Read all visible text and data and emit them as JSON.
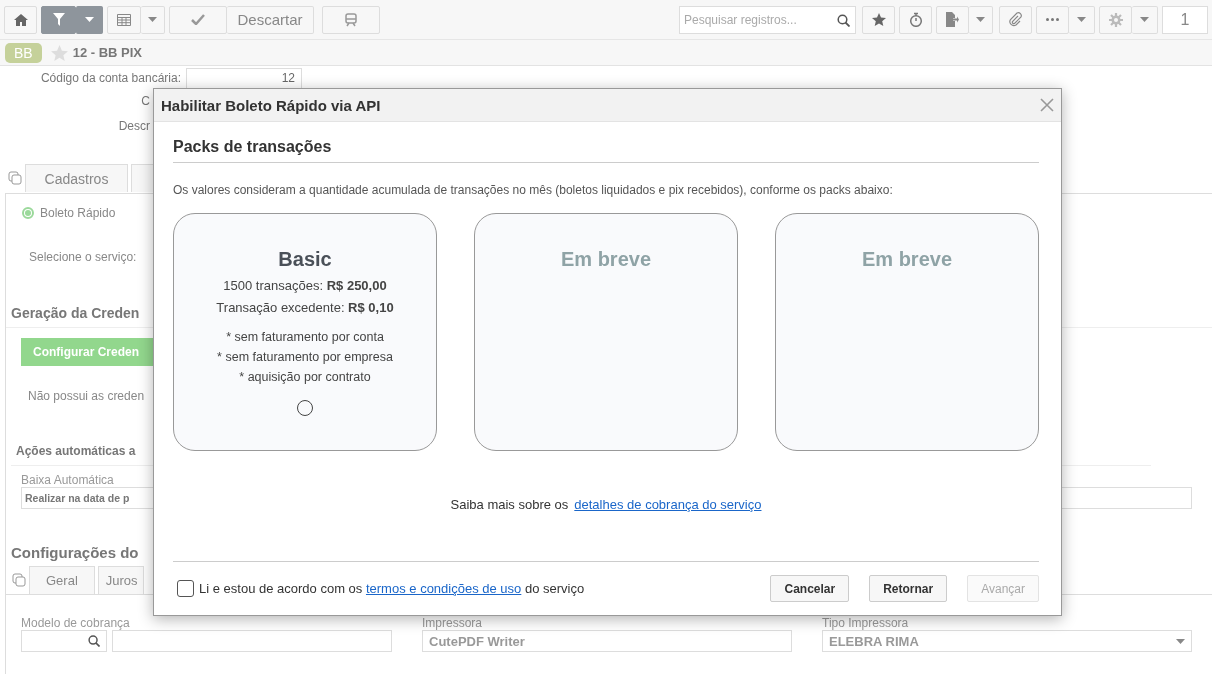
{
  "toolbar": {
    "filter": {
      "selected": true
    },
    "discard_label": "Descartar",
    "search_placeholder": "Pesquisar registros...",
    "counter": "1"
  },
  "record": {
    "badge": "BB",
    "starred": false,
    "title": "12 - BB PIX"
  },
  "form_fields": [
    {
      "label": "Código da conta bancária:",
      "value": "12"
    },
    {
      "label": "C"
    },
    {
      "label": "Descr"
    }
  ],
  "tabs": [
    {
      "label": "Cadastros"
    }
  ],
  "service": {
    "option": "Boleto Rápido",
    "selected": true,
    "label": "Selecione o serviço:"
  },
  "credentials": {
    "heading": "Geração da Creden",
    "button": "Configurar Creden",
    "note": "Não possui as creden"
  },
  "actions": {
    "heading": "Ações automáticas a",
    "field_label": "Baixa Automática",
    "field_value": "Realizar na data de p"
  },
  "config": {
    "heading": "Configurações do",
    "tabs": [
      {
        "label": "Geral"
      },
      {
        "label": "Juros"
      }
    ],
    "model_label": "Modelo de cobrança",
    "printer_label": "Impressora",
    "printer_value": "CutePDF Writer",
    "printer_type_label": "Tipo Impressora",
    "printer_type_value": "ELEBRA RIMA"
  },
  "dialog": {
    "title": "Habilitar Boleto Rápido via API",
    "section_title": "Packs de transações",
    "intro": "Os valores consideram a quantidade acumulada de transações no mês (boletos liquidados e pix recebidos), conforme os packs abaixo:",
    "packs": [
      {
        "kind": "plan",
        "title": "Basic",
        "prices": [
          "1500 transações: **R$ 250,00**",
          "Transação excedente: **R$ 0,10**"
        ],
        "notes": [
          "* sem faturamento por conta",
          "* sem faturamento por empresa",
          "* aquisição por contrato"
        ],
        "selected": false
      },
      {
        "kind": "soon",
        "title": "Em breve"
      },
      {
        "kind": "soon",
        "title": "Em breve"
      }
    ],
    "info_text": "Saiba mais sobre os",
    "info_link": "detalhes de cobrança do serviço",
    "agreement": {
      "checked": false,
      "before": "Li e estou de acordo com os",
      "link": "termos e condições de uso",
      "after": "do serviço"
    },
    "buttons": [
      {
        "label": "Cancelar",
        "disabled": false
      },
      {
        "label": "Retornar",
        "disabled": false
      },
      {
        "label": "Avançar",
        "disabled": true
      }
    ]
  }
}
